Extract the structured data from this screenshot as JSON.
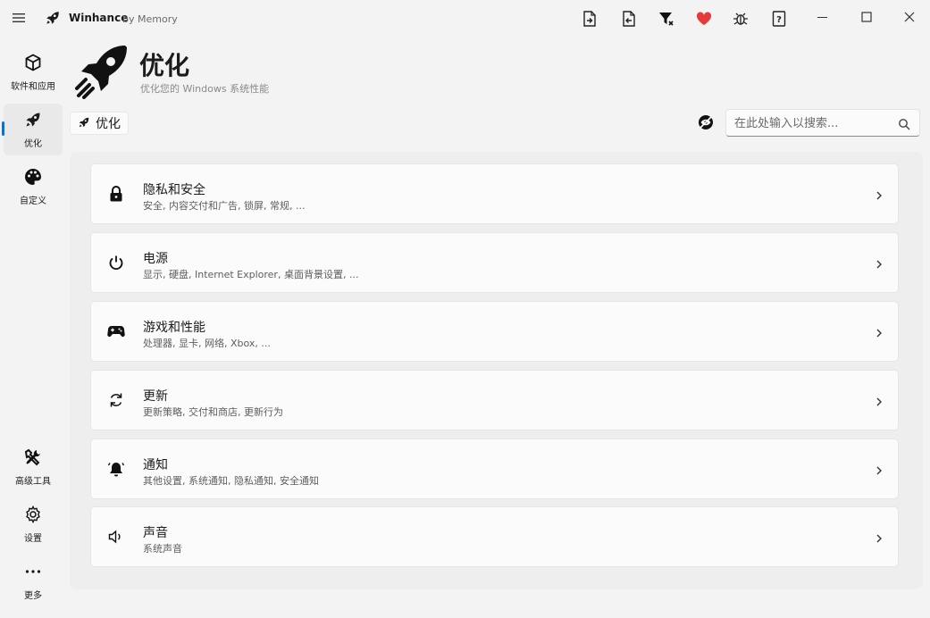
{
  "app": {
    "name": "Winhance",
    "by": "by Memory"
  },
  "titlebar_icons": [
    "export-config-icon",
    "import-config-icon",
    "filter-icon",
    "heart-icon",
    "bug-icon",
    "help-icon"
  ],
  "sidebar": {
    "items": [
      {
        "label": "软件和应用",
        "icon": "cube-icon"
      },
      {
        "label": "优化",
        "icon": "rocket-icon",
        "active": true
      },
      {
        "label": "自定义",
        "icon": "palette-icon"
      },
      {
        "label": "高级工具",
        "icon": "tools-icon"
      },
      {
        "label": "设置",
        "icon": "gear-icon"
      },
      {
        "label": "更多",
        "icon": "more-dots-icon"
      }
    ]
  },
  "header": {
    "title": "优化",
    "subtitle": "优化您的 Windows 系统性能"
  },
  "breadcrumb": {
    "label": "优化"
  },
  "search": {
    "placeholder": "在此处输入以搜索..."
  },
  "cards": [
    {
      "title": "隐私和安全",
      "desc": "安全, 内容交付和广告, 锁屏, 常规, ...",
      "icon": "lock-icon"
    },
    {
      "title": "电源",
      "desc": "显示, 硬盘, Internet Explorer, 桌面背景设置, ...",
      "icon": "power-icon"
    },
    {
      "title": "游戏和性能",
      "desc": "处理器, 显卡, 网络, Xbox, ...",
      "icon": "gamepad-icon"
    },
    {
      "title": "更新",
      "desc": "更新策略, 交付和商店, 更新行为",
      "icon": "sync-icon"
    },
    {
      "title": "通知",
      "desc": "其他设置, 系统通知, 隐私通知, 安全通知",
      "icon": "bell-icon"
    },
    {
      "title": "声音",
      "desc": "系统声音",
      "icon": "speaker-icon"
    }
  ],
  "colors": {
    "accent": "#1a6ec2",
    "heart": "#e5393b",
    "text": "#1b1b1b"
  }
}
